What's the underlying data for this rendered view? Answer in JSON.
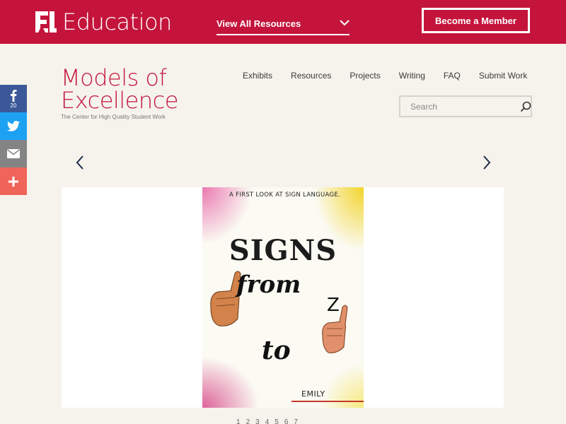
{
  "header": {
    "logo_text": "Education",
    "resources_label": "View All Resources",
    "member_label": "Become a Member"
  },
  "brand": {
    "title_line1": "Models of",
    "title_line2": "Excellence",
    "subtitle": "The Center for High Quality Student Work"
  },
  "nav": {
    "items": [
      "Exhibits",
      "Resources",
      "Projects",
      "Writing",
      "FAQ",
      "Submit Work"
    ]
  },
  "search": {
    "placeholder": "Search"
  },
  "social": {
    "facebook_count": "20"
  },
  "artwork": {
    "header": "A FIRST LOOK AT SIGN LANGUAGE.",
    "word1": "SIGNS",
    "word2": "from",
    "letter": "Z",
    "word3": "to",
    "author": "EMILY"
  },
  "pager": [
    "1",
    "2",
    "3",
    "4",
    "5",
    "6",
    "7"
  ],
  "colors": {
    "brand": "#c4143c",
    "background": "#f5f3ec",
    "facebook": "#3b5998",
    "twitter": "#1da1f2",
    "email": "#848484",
    "share": "#f0655a"
  },
  "icons": {
    "logo": "el-logo-icon",
    "dropdown": "chevron-down-icon",
    "search": "search-icon",
    "facebook": "facebook-icon",
    "twitter": "twitter-icon",
    "email": "email-icon",
    "share": "plus-icon",
    "prev": "chevron-left-icon",
    "next": "chevron-right-icon"
  }
}
